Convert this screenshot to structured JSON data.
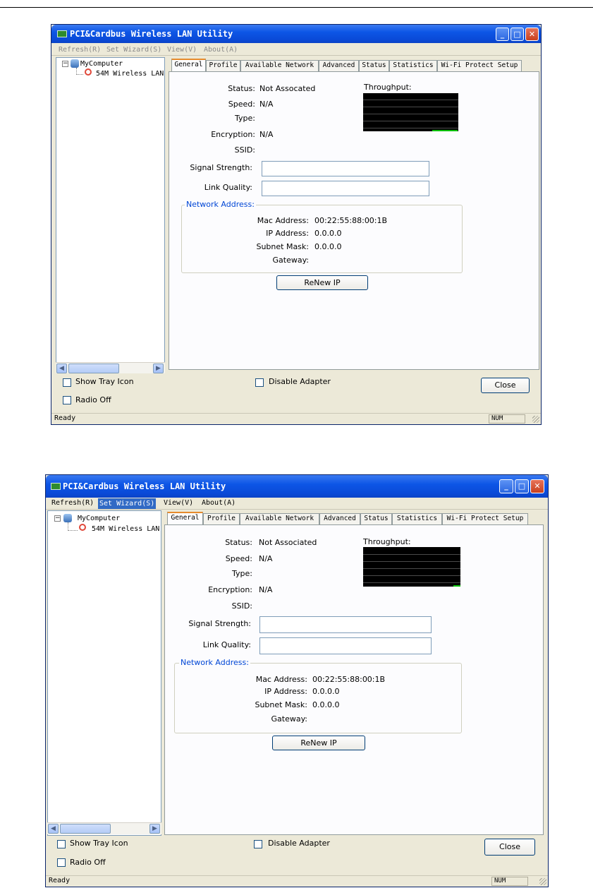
{
  "windows": [
    {
      "title": "PCI&Cardbus Wireless LAN Utility",
      "menu": [
        "Refresh(R)",
        "Set Wizard(S)",
        "View(V)",
        "About(A)"
      ],
      "tree": {
        "root": "MyComputer",
        "child": "54M Wireless LAN"
      },
      "tabs": [
        "General",
        "Profile",
        "Available Network",
        "Advanced",
        "Status",
        "Statistics",
        "Wi-Fi Protect Setup"
      ],
      "active_tab": "General",
      "general": {
        "status_label": "Status:",
        "status_value": "Not Assocated",
        "speed_label": "Speed:",
        "speed_value": "N/A",
        "type_label": "Type:",
        "encryption_label": "Encryption:",
        "encryption_value": "N/A",
        "ssid_label": "SSID:",
        "signal_label": "Signal Strength:",
        "link_label": "Link Quality:",
        "throughput_label": "Throughput:"
      },
      "network": {
        "title": "Network Address:",
        "mac_label": "Mac Address:",
        "mac_value": "00:22:55:88:00:1B",
        "ip_label": "IP Address:",
        "ip_value": "0.0.0.0",
        "subnet_label": "Subnet Mask:",
        "subnet_value": "0.0.0.0",
        "gateway_label": "Gateway:"
      },
      "renew_label": "ReNew IP",
      "show_tray": "Show Tray Icon",
      "disable_adapter": "Disable Adapter",
      "radio_off": "Radio Off",
      "close_label": "Close",
      "status_text": "Ready",
      "num_text": "NUM",
      "menu_enabled": false
    },
    {
      "title": "PCI&Cardbus Wireless LAN Utility",
      "menu": [
        "Refresh(R)",
        "Set Wizard(S)",
        "View(V)",
        "About(A)"
      ],
      "menu_highlighted": "Set Wizard(S)",
      "tree": {
        "root": "MyComputer",
        "child": "54M Wireless LAN"
      },
      "tabs": [
        "General",
        "Profile",
        "Available Network",
        "Advanced",
        "Status",
        "Statistics",
        "Wi-Fi Protect Setup"
      ],
      "active_tab": "General",
      "general": {
        "status_label": "Status:",
        "status_value": "Not Associated",
        "speed_label": "Speed:",
        "speed_value": "N/A",
        "type_label": "Type:",
        "encryption_label": "Encryption:",
        "encryption_value": "N/A",
        "ssid_label": "SSID:",
        "signal_label": "Signal Strength:",
        "link_label": "Link Quality:",
        "throughput_label": "Throughput:"
      },
      "network": {
        "title": "Network Address:",
        "mac_label": "Mac Address:",
        "mac_value": "00:22:55:88:00:1B",
        "ip_label": "IP Address:",
        "ip_value": "0.0.0.0",
        "subnet_label": "Subnet Mask:",
        "subnet_value": "0.0.0.0",
        "gateway_label": "Gateway:"
      },
      "renew_label": "ReNew IP",
      "show_tray": "Show Tray Icon",
      "disable_adapter": "Disable Adapter",
      "radio_off": "Radio Off",
      "close_label": "Close",
      "status_text": "Ready",
      "num_text": "NUM",
      "menu_enabled": true
    }
  ],
  "icons": {
    "app": "wireless-card-icon",
    "minimize": "minimize-icon",
    "maximize": "maximize-icon",
    "close": "close-icon",
    "computer": "computer-icon",
    "adapter": "wireless-adapter-icon",
    "scroll_left": "arrow-left-icon",
    "scroll_right": "arrow-right-icon",
    "resize": "resize-grip-icon"
  },
  "colors": {
    "title_bar": "#0a4ad8",
    "group_title": "#0046d5",
    "active_tab_accent": "#e68b2c",
    "signal": "#00c000",
    "window_bg": "#ece9d8"
  }
}
